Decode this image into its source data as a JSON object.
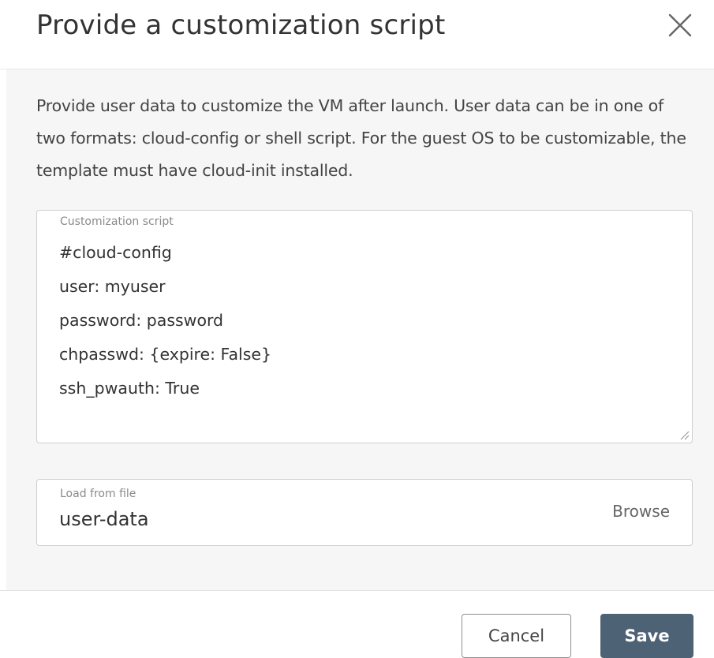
{
  "dialog": {
    "title": "Provide a customization script",
    "close_icon": "close-icon"
  },
  "body": {
    "description": "Provide user data to customize the VM after launch. User data can be in one of two formats: cloud-config or shell script. For the guest OS to be customizable, the template must have cloud-init installed.",
    "script_field": {
      "label": "Customization script",
      "value": "#cloud-config\nuser: myuser\npassword: password\nchpasswd: {expire: False}\nssh_pwauth: True"
    },
    "file_field": {
      "label": "Load from file",
      "value": "user-data",
      "browse_label": "Browse"
    }
  },
  "footer": {
    "cancel_label": "Cancel",
    "save_label": "Save"
  },
  "colors": {
    "save_button_bg": "#4e6275",
    "body_bg": "#f6f6f6",
    "border": "#cfcfcf"
  }
}
